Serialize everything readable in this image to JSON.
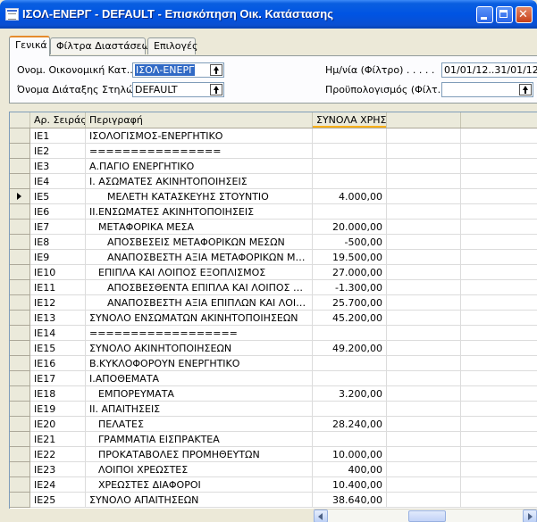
{
  "window": {
    "title": "ΙΣΟΛ-ΕΝΕΡΓ - DEFAULT - Επισκόπηση Οικ. Κατάστασης"
  },
  "tabs": [
    {
      "label": "Γενικά",
      "active": true
    },
    {
      "label": "Φίλτρα Διαστάσεων",
      "active": false
    },
    {
      "label": "Επιλογές",
      "active": false
    }
  ],
  "form": {
    "financial_statement_label": "Ονομ. Οικονομική Κατ...",
    "financial_statement_value": "ΙΣΟΛ-ΕΝΕΡΓ",
    "column_layout_label": "Όνομα Διάταξης Στηλών.",
    "column_layout_value": "DEFAULT",
    "date_filter_label": "Ημ/νία (Φίλτρο) . . . . .",
    "date_filter_value": "01/01/12..31/01/12",
    "budget_filter_label": "Προϋπολογισμός (Φίλτ...",
    "budget_filter_value": ""
  },
  "grid": {
    "columns": [
      "Αρ. Σειράς",
      "Περιγραφή",
      "ΣΥΝΟΛΑ ΧΡΗΣΗ"
    ],
    "current_row_index": 4,
    "rows": [
      {
        "no": "IE1",
        "desc": "ΙΣΟΛΟΓΙΣΜΟΣ-ΕΝΕΡΓΗΤΙΚΟ",
        "amount": ""
      },
      {
        "no": "IE2",
        "desc": "================",
        "amount": ""
      },
      {
        "no": "IE3",
        "desc": "Α.ΠΑΓΙΟ ΕΝΕΡΓΗΤΙΚΟ",
        "amount": ""
      },
      {
        "no": "IE4",
        "desc": "Ι. ΑΣΩΜΑΤΕΣ ΑΚΙΝΗΤΟΠΟΙΗΣΕΙΣ",
        "amount": ""
      },
      {
        "no": "IE5",
        "desc": "ΜΕΛΕΤΗ ΚΑΤΑΣΚΕΥΗΣ ΣΤΟΥΝΤΙΟ",
        "amount": "4.000,00"
      },
      {
        "no": "IE6",
        "desc": "ΙΙ.ΕΝΣΩΜΑΤΕΣ ΑΚΙΝΗΤΟΠΟΙΗΣΕΙΣ",
        "amount": ""
      },
      {
        "no": "IE7",
        "desc": "ΜΕΤΑΦΟΡΙΚΑ ΜΕΣΑ",
        "amount": "20.000,00"
      },
      {
        "no": "IE8",
        "desc": "ΑΠΟΣΒΕΣΕΙΣ ΜΕΤΑΦΟΡΙΚΩΝ ΜΕΣΩΝ",
        "amount": "-500,00"
      },
      {
        "no": "IE9",
        "desc": "ΑΝΑΠΟΣΒΕΣΤΗ ΑΞΙΑ ΜΕΤΑΦΟΡΙΚΩΝ ΜΕΣΩΝ",
        "amount": "19.500,00"
      },
      {
        "no": "IE10",
        "desc": "ΕΠΙΠΛΑ ΚΑΙ ΛΟΙΠΟΣ ΕΞΟΠΛΙΣΜΟΣ",
        "amount": "27.000,00"
      },
      {
        "no": "IE11",
        "desc": "ΑΠΟΣΒΕΣΘΕΝΤΑ ΕΠΙΠΛΑ ΚΑΙ ΛΟΙΠΟΣ ΕΞΟΠ...",
        "amount": "-1.300,00"
      },
      {
        "no": "IE12",
        "desc": "ΑΝΑΠΟΣΒΕΣΤΗ ΑΞΙΑ ΕΠΙΠΛΩΝ ΚΑΙ ΛΟΙΠΟΥ Ε...",
        "amount": "25.700,00"
      },
      {
        "no": "IE13",
        "desc": "ΣΥΝΟΛΟ ΕΝΣΩΜΑΤΩΝ ΑΚΙΝΗΤΟΠΟΙΗΣΕΩΝ",
        "amount": "45.200,00"
      },
      {
        "no": "IE14",
        "desc": "==================",
        "amount": ""
      },
      {
        "no": "IE15",
        "desc": "ΣΥΝΟΛΟ ΑΚΙΝΗΤΟΠΟΙΗΣΕΩΝ",
        "amount": "49.200,00"
      },
      {
        "no": "IE16",
        "desc": "Β.ΚΥΚΛΟΦΟΡΟΥΝ ΕΝΕΡΓΗΤΙΚΟ",
        "amount": ""
      },
      {
        "no": "IE17",
        "desc": "Ι.ΑΠΟΘΕΜΑΤΑ",
        "amount": ""
      },
      {
        "no": "IE18",
        "desc": "ΕΜΠΟΡΕΥΜΑΤΑ",
        "amount": "3.200,00"
      },
      {
        "no": "IE19",
        "desc": "ΙΙ. ΑΠΑΙΤΗΣΕΙΣ",
        "amount": ""
      },
      {
        "no": "IE20",
        "desc": "ΠΕΛΑΤΕΣ",
        "amount": "28.240,00"
      },
      {
        "no": "IE21",
        "desc": "ΓΡΑΜΜΑΤΙΑ ΕΙΣΠΡΑΚΤΕΑ",
        "amount": ""
      },
      {
        "no": "IE22",
        "desc": "ΠΡΟΚΑΤΑΒΟΛΕΣ ΠΡΟΜΗΘΕΥΤΩΝ",
        "amount": "10.000,00"
      },
      {
        "no": "IE23",
        "desc": "ΛΟΙΠΟΙ ΧΡΕΩΣΤΕΣ",
        "amount": "400,00"
      },
      {
        "no": "IE24",
        "desc": "ΧΡΕΩΣΤΕΣ ΔΙΑΦΟΡΟΙ",
        "amount": "10.400,00"
      },
      {
        "no": "IE25",
        "desc": "ΣΥΝΟΛΟ ΑΠΑΙΤΗΣΕΩΝ",
        "amount": "38.640,00"
      }
    ]
  },
  "icons": {
    "app": "financial-statement-icon",
    "lookup": "lookup-up-arrow-icon",
    "current_row": "current-row-triangle-icon"
  }
}
